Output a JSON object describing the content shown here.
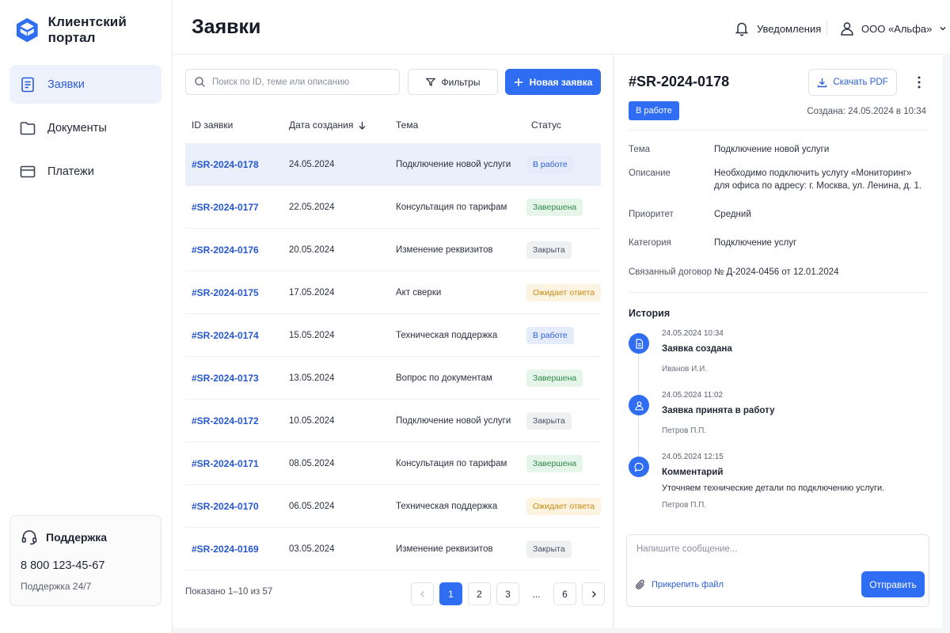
{
  "brand": {
    "name": "Клиентский портал",
    "logo": "cube-logo-icon",
    "accent": "#2f6df2"
  },
  "sidebar": {
    "items": [
      {
        "label": "Заявки",
        "icon": "document-list-icon",
        "active": true
      },
      {
        "label": "Документы",
        "icon": "folder-icon",
        "active": false
      },
      {
        "label": "Платежи",
        "icon": "card-icon",
        "active": false
      }
    ],
    "support": {
      "title": "Поддержка",
      "icon": "headset-icon",
      "phone": "8 800 123-45-67",
      "hours": "Поддержка 24/7"
    }
  },
  "header": {
    "title": "Заявки",
    "notifications_label": "Уведомления",
    "org_label": "ООО «Альфа»"
  },
  "list": {
    "search_placeholder": "Поиск по ID, теме или описанию",
    "filter_label": "Фильтры",
    "new_label": "Новая заявка",
    "columns": [
      "ID заявки",
      "Дата создания",
      "Тема",
      "Статус"
    ],
    "sort_column": "Дата создания",
    "rows": [
      {
        "id": "#SR-2024-0178",
        "date": "24.05.2024",
        "topic": "Подключение новой услуги",
        "status": "В работе",
        "kind": "work"
      },
      {
        "id": "#SR-2024-0177",
        "date": "22.05.2024",
        "topic": "Консультация по тарифам",
        "status": "Завершена",
        "kind": "done"
      },
      {
        "id": "#SR-2024-0176",
        "date": "20.05.2024",
        "topic": "Изменение реквизитов",
        "status": "Закрыта",
        "kind": "closed"
      },
      {
        "id": "#SR-2024-0175",
        "date": "17.05.2024",
        "topic": "Акт сверки",
        "status": "Ожидает ответа",
        "kind": "wait"
      },
      {
        "id": "#SR-2024-0174",
        "date": "15.05.2024",
        "topic": "Техническая поддержка",
        "status": "В работе",
        "kind": "work"
      },
      {
        "id": "#SR-2024-0173",
        "date": "13.05.2024",
        "topic": "Вопрос по документам",
        "status": "Завершена",
        "kind": "done"
      },
      {
        "id": "#SR-2024-0172",
        "date": "10.05.2024",
        "topic": "Подключение новой услуги",
        "status": "Закрыта",
        "kind": "closed"
      },
      {
        "id": "#SR-2024-0171",
        "date": "08.05.2024",
        "topic": "Консультация по тарифам",
        "status": "Завершена",
        "kind": "done"
      },
      {
        "id": "#SR-2024-0170",
        "date": "06.05.2024",
        "topic": "Техническая поддержка",
        "status": "Ожидает ответа",
        "kind": "wait"
      },
      {
        "id": "#SR-2024-0169",
        "date": "03.05.2024",
        "topic": "Изменение реквизитов",
        "status": "Закрыта",
        "kind": "closed"
      }
    ],
    "selected_index": 0,
    "shown": "Показано 1–10 из 57",
    "pages": [
      "1",
      "2",
      "3",
      "...",
      "6"
    ],
    "current_page": "1"
  },
  "detail": {
    "id": "#SR-2024-0178",
    "pdf_label": "Скачать PDF",
    "status": "В работе",
    "created": "Создана: 24.05.2024 в 10:34",
    "fields": [
      {
        "label": "Тема",
        "value": "Подключение новой услуги"
      },
      {
        "label": "Описание",
        "value": "Необходимо подключить услугу «Мониторинг» для офиса по адресу: г. Москва, ул. Ленина, д. 1."
      },
      {
        "label": "Приоритет",
        "value": "Средний"
      },
      {
        "label": "Категория",
        "value": "Подключение услуг"
      },
      {
        "label": "Связанный договор",
        "value": "№ Д-2024-0456 от 12.01.2024"
      }
    ],
    "history_title": "История",
    "history": [
      {
        "time": "24.05.2024 10:34",
        "title": "Заявка создана",
        "text": "",
        "author": "Иванов И.И.",
        "icon": "document-icon"
      },
      {
        "time": "24.05.2024 11:02",
        "title": "Заявка принята в работу",
        "text": "",
        "author": "Петров П.П.",
        "icon": "user-icon"
      },
      {
        "time": "24.05.2024 12:15",
        "title": "Комментарий",
        "text": "Уточняем технические детали по подключению услуги.",
        "author": "Петров П.П.",
        "icon": "chat-icon"
      }
    ],
    "composer": {
      "placeholder": "Напишите сообщение...",
      "attach_label": "Прикрепить файл",
      "send_label": "Отправить"
    }
  }
}
